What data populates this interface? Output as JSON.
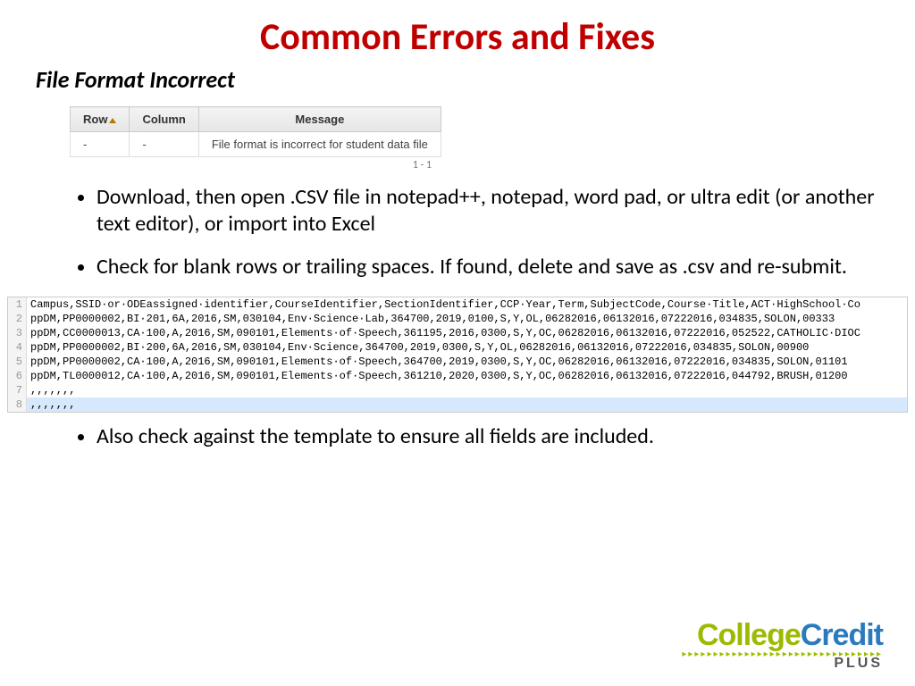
{
  "title": "Common Errors and Fixes",
  "subtitle": "File Format Incorrect",
  "table": {
    "headers": {
      "row": "Row",
      "column": "Column",
      "message": "Message"
    },
    "cells": {
      "row": "-",
      "column": "-",
      "message": "File format is incorrect for student data file"
    },
    "footer": "1 - 1"
  },
  "bullets_top": [
    "Download, then open .CSV file in notepad++, notepad, word pad, or ultra edit (or another text editor), or import into Excel",
    "Check for blank rows or trailing spaces. If found, delete and save as .csv and re-submit."
  ],
  "csv": {
    "lines": [
      "Campus,SSID·or·ODEassigned·identifier,CourseIdentifier,SectionIdentifier,CCP·Year,Term,SubjectCode,Course·Title,ACT·HighSchool·Co",
      "ppDM,PP0000002,BI·201,6A,2016,SM,030104,Env·Science·Lab,364700,2019,0100,S,Y,OL,06282016,06132016,07222016,034835,SOLON,00333",
      "ppDM,CC0000013,CA·100,A,2016,SM,090101,Elements·of·Speech,361195,2016,0300,S,Y,OC,06282016,06132016,07222016,052522,CATHOLIC·DIOC",
      "ppDM,PP0000002,BI·200,6A,2016,SM,030104,Env·Science,364700,2019,0300,S,Y,OL,06282016,06132016,07222016,034835,SOLON,00900",
      "ppDM,PP0000002,CA·100,A,2016,SM,090101,Elements·of·Speech,364700,2019,0300,S,Y,OC,06282016,06132016,07222016,034835,SOLON,01101",
      "ppDM,TL0000012,CA·100,A,2016,SM,090101,Elements·of·Speech,361210,2020,0300,S,Y,OC,06282016,06132016,07222016,044792,BRUSH,01200",
      ",,,,,,,",
      ",,,,,,,"
    ]
  },
  "bullets_bottom": [
    "Also check against the template to ensure all fields are included."
  ],
  "logo": {
    "part1": "College",
    "part2": "Credit",
    "plus": "PLUS"
  }
}
